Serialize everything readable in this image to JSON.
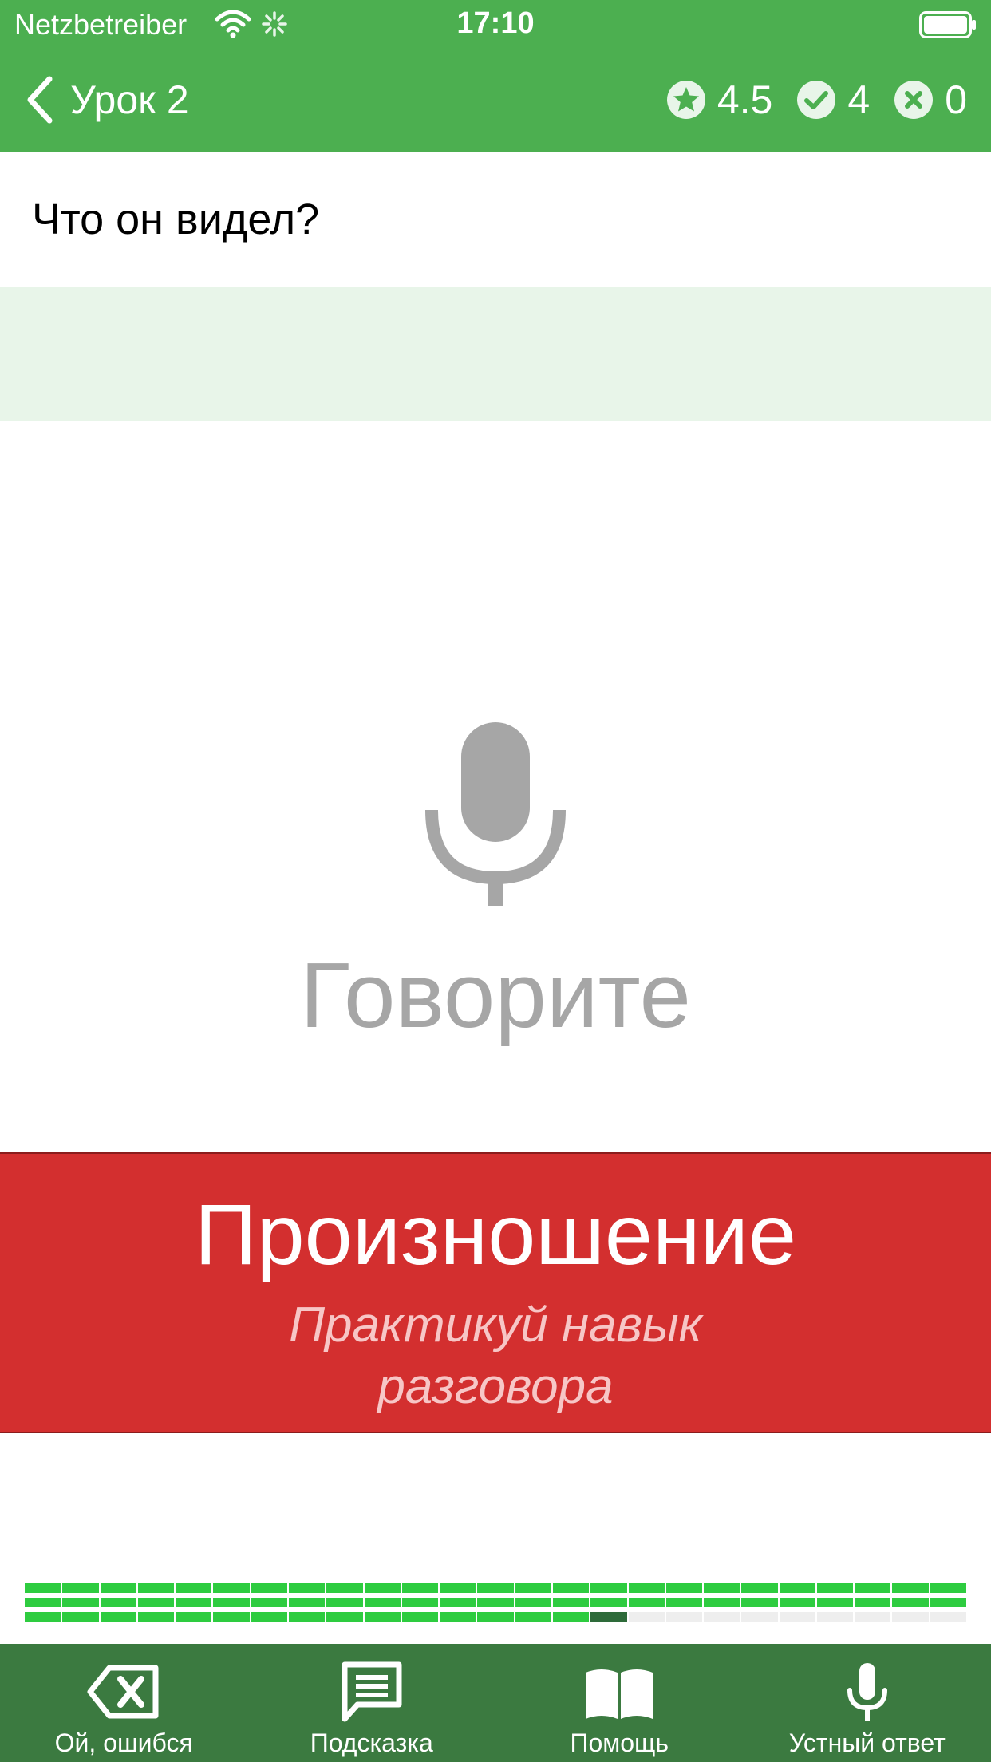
{
  "status_bar": {
    "carrier": "Netzbetreiber",
    "time": "17:10"
  },
  "nav": {
    "back_label": "Урок 2",
    "stats": {
      "rating": "4.5",
      "correct": "4",
      "wrong": "0"
    }
  },
  "question": {
    "text": "Что он видел?"
  },
  "voice": {
    "prompt": "Говорите"
  },
  "banner": {
    "title": "Произношение",
    "subtitle_line1": "Практикуй навык",
    "subtitle_line2": "разговора"
  },
  "progress": {
    "segments_total": 25,
    "segments_completed": 15,
    "current_segment": 16
  },
  "tabbar": {
    "items": [
      {
        "label": "Ой, ошибся",
        "icon": "backspace-icon"
      },
      {
        "label": "Подсказка",
        "icon": "chat-bubble-icon"
      },
      {
        "label": "Помощь",
        "icon": "book-icon"
      },
      {
        "label": "Устный ответ",
        "icon": "microphone-icon"
      }
    ]
  },
  "colors": {
    "primary_green": "#4caf50",
    "tabbar_green": "#3b7a40",
    "banner_red": "#d32f2f",
    "progress_green": "#2ecc40",
    "answer_bg": "#e8f5e9"
  }
}
